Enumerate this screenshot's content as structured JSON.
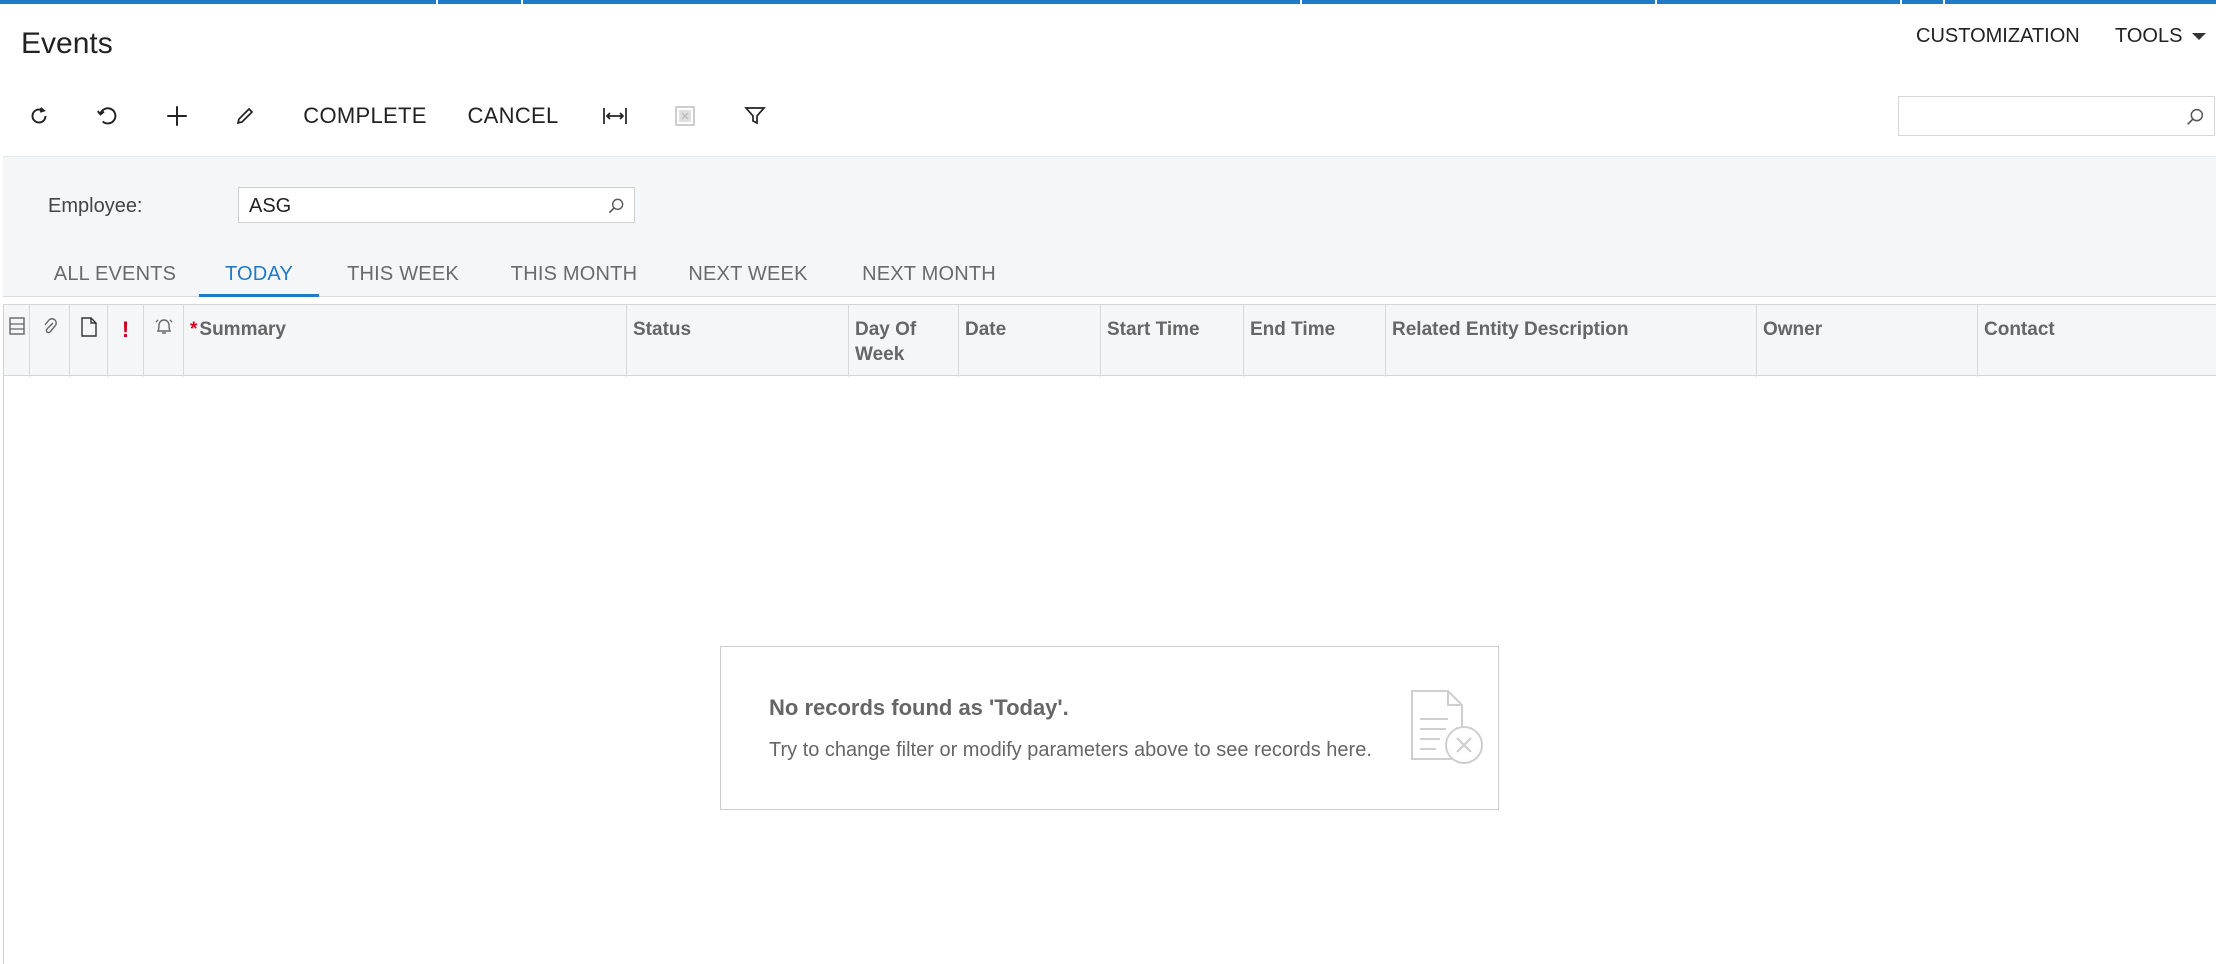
{
  "page": {
    "title": "Events"
  },
  "header_menu": {
    "customization": "CUSTOMIZATION",
    "tools": "TOOLS"
  },
  "toolbar": {
    "complete": "COMPLETE",
    "cancel": "CANCEL",
    "icons": [
      "refresh-icon",
      "undo-icon",
      "add-icon",
      "edit-icon",
      "fit-width-icon",
      "export-excel-icon",
      "filter-icon"
    ]
  },
  "search": {
    "value": "",
    "placeholder": ""
  },
  "filter": {
    "employee_label": "Employee:",
    "employee_value": "ASG"
  },
  "tabs": [
    {
      "label": "ALL EVENTS",
      "active": false
    },
    {
      "label": "TODAY",
      "active": true
    },
    {
      "label": "THIS WEEK",
      "active": false
    },
    {
      "label": "THIS MONTH",
      "active": false
    },
    {
      "label": "NEXT WEEK",
      "active": false
    },
    {
      "label": "NEXT MONTH",
      "active": false
    }
  ],
  "grid": {
    "columns": {
      "summary": "Summary",
      "status": "Status",
      "day_of_week": "Day Of Week",
      "date": "Date",
      "start_time": "Start Time",
      "end_time": "End Time",
      "related": "Related Entity Description",
      "owner": "Owner",
      "contact": "Contact"
    },
    "priority_mark": "!",
    "required_mark": "*"
  },
  "empty_state": {
    "title": "No records found as 'Today'.",
    "description": "Try to change filter or modify parameters above to see records here."
  },
  "colors": {
    "accent": "#1f7ac8",
    "required": "#d0021b"
  }
}
